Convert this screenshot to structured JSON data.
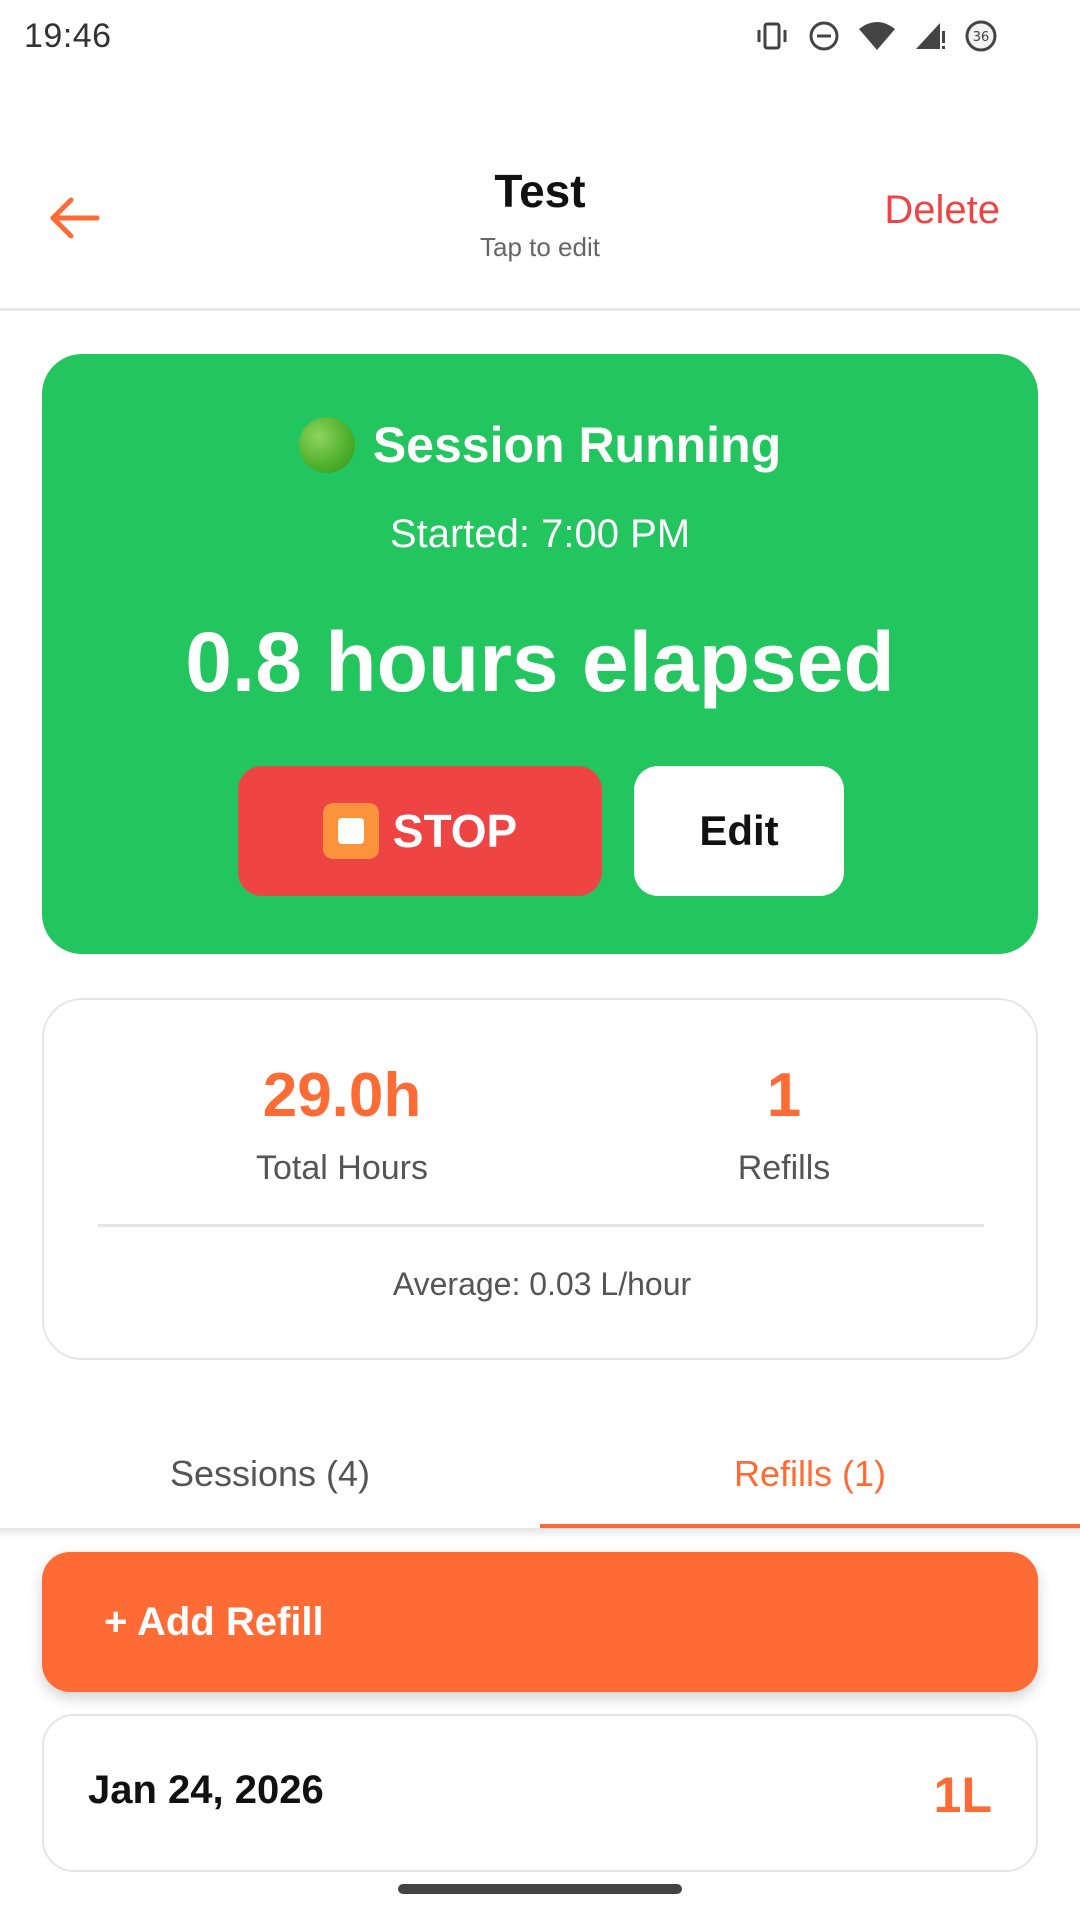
{
  "status_bar": {
    "time": "19:46",
    "icons": [
      "vibrate-icon",
      "do-not-disturb-icon",
      "wifi-icon",
      "signal-icon",
      "battery-icon"
    ],
    "battery_level": "36"
  },
  "header": {
    "title": "Test",
    "subtitle": "Tap to edit",
    "delete_label": "Delete"
  },
  "session": {
    "status": "Session Running",
    "started": "Started: 7:00 PM",
    "elapsed": "0.8 hours elapsed",
    "stop_label": "STOP",
    "edit_label": "Edit"
  },
  "stats": {
    "total_hours_value": "29.0h",
    "total_hours_label": "Total Hours",
    "refills_value": "1",
    "refills_label": "Refills",
    "average": "Average: 0.03 L/hour"
  },
  "tabs": [
    {
      "label": "Sessions (4)",
      "active": false
    },
    {
      "label": "Refills (1)",
      "active": true
    }
  ],
  "add_refill_label": "+ Add Refill",
  "refills": [
    {
      "date": "Jan 24, 2026",
      "amount": "1L"
    }
  ],
  "colors": {
    "accent": "#ff6b35",
    "running": "#22c55e",
    "danger": "#ef4444"
  }
}
